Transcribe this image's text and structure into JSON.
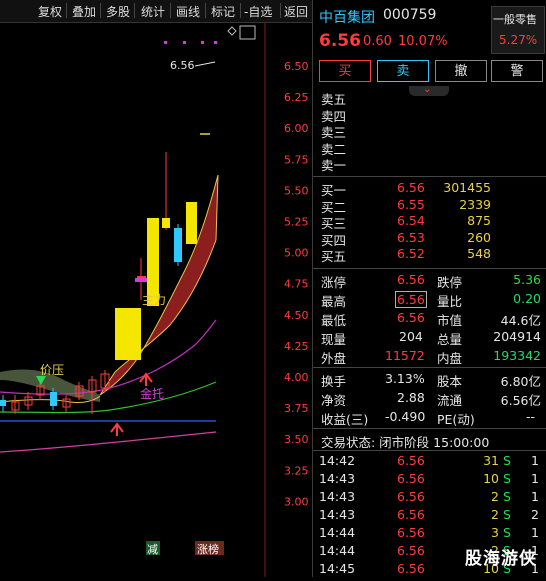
{
  "toolbar": {
    "items": [
      "复权",
      "叠加",
      "多股",
      "统计",
      "画线",
      "标记",
      "-自选",
      "返回"
    ]
  },
  "chart": {
    "price_ticks": [
      "6.50",
      "6.25",
      "6.00",
      "5.75",
      "5.50",
      "5.25",
      "5.00",
      "4.75",
      "4.50",
      "4.25",
      "4.00",
      "3.75",
      "3.50",
      "3.25",
      "3.00"
    ],
    "last_price_tag": "6.56",
    "annotations": {
      "price_pressure": "价压",
      "main_force": "主力",
      "gold_support": "金托"
    },
    "bottom_badges": {
      "reduce": "减",
      "limit_list": "涨榜"
    }
  },
  "stock": {
    "name": "中百集团",
    "code": "000759",
    "odd_lot_label": "一般零售",
    "price": "6.56",
    "change": "0.60",
    "change_pct": "10.07%",
    "sector_pct": "5.27%"
  },
  "actions": {
    "buy": "买",
    "sell": "卖",
    "cancel": "撤",
    "alert": "警"
  },
  "asks": [
    {
      "label": "卖五",
      "price": "",
      "vol": ""
    },
    {
      "label": "卖四",
      "price": "",
      "vol": ""
    },
    {
      "label": "卖三",
      "price": "",
      "vol": ""
    },
    {
      "label": "卖二",
      "price": "",
      "vol": ""
    },
    {
      "label": "卖一",
      "price": "",
      "vol": ""
    }
  ],
  "bids": [
    {
      "label": "买一",
      "price": "6.56",
      "vol": "301455"
    },
    {
      "label": "买二",
      "price": "6.55",
      "vol": "2339"
    },
    {
      "label": "买三",
      "price": "6.54",
      "vol": "875"
    },
    {
      "label": "买四",
      "price": "6.53",
      "vol": "260"
    },
    {
      "label": "买五",
      "price": "6.52",
      "vol": "548"
    }
  ],
  "stats": {
    "limit_up_label": "涨停",
    "limit_up": "6.56",
    "limit_down_label": "跌停",
    "limit_down": "5.36",
    "high_label": "最高",
    "high": "6.56",
    "vol_ratio_label": "量比",
    "vol_ratio": "0.20",
    "low_label": "最低",
    "low": "6.56",
    "mkt_cap_label": "市值",
    "mkt_cap": "44.6亿",
    "now_vol_label": "现量",
    "now_vol": "204",
    "total_vol_label": "总量",
    "total_vol": "204914",
    "outer_label": "外盘",
    "outer": "11572",
    "inner_label": "内盘",
    "inner": "193342",
    "turnover_label": "换手",
    "turnover": "3.13%",
    "equity_label": "股本",
    "equity": "6.80亿",
    "nav_label": "净资",
    "nav": "2.88",
    "float_label": "流通",
    "float": "6.56亿",
    "eps_label": "收益(三)",
    "eps": "-0.490",
    "pe_label": "PE(动)",
    "pe": "--"
  },
  "trade_status": "交易状态: 闭市阶段 15:00:00",
  "ticks": [
    {
      "time": "14:42",
      "price": "6.56",
      "vol": "31",
      "side": "S",
      "n": "1"
    },
    {
      "time": "14:43",
      "price": "6.56",
      "vol": "10",
      "side": "S",
      "n": "1"
    },
    {
      "time": "14:43",
      "price": "6.56",
      "vol": "2",
      "side": "S",
      "n": "1"
    },
    {
      "time": "14:43",
      "price": "6.56",
      "vol": "2",
      "side": "S",
      "n": "2"
    },
    {
      "time": "14:44",
      "price": "6.56",
      "vol": "3",
      "side": "S",
      "n": "1"
    },
    {
      "time": "14:44",
      "price": "6.56",
      "vol": "2",
      "side": "S",
      "n": "1"
    },
    {
      "time": "14:45",
      "price": "6.56",
      "vol": "10",
      "side": "S",
      "n": "1"
    }
  ],
  "watermark": "股海游侠",
  "colors": {
    "up": "#ff3c3c",
    "down": "#22dd55",
    "accent_yellow": "#e8d24a",
    "cyan": "#30c8ff"
  }
}
